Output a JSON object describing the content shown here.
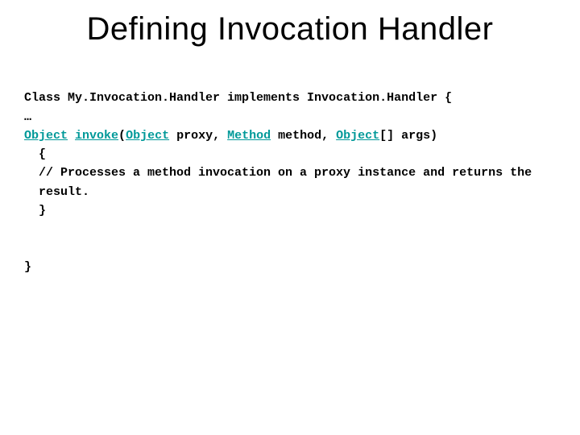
{
  "title": "Defining  Invocation Handler",
  "code": {
    "line1_a": "Class My.Invocation.Handler implements Invocation.Handler {",
    "line2": "…",
    "l3_object": "Object",
    "l3_sp1": " ",
    "l3_invoke": "invoke",
    "l3_paren": "(",
    "l3_object2": "Object",
    "l3_proxy": " proxy, ",
    "l3_method": "Method",
    "l3_methodarg": " method, ",
    "l3_object3": "Object",
    "l3_args": "[] args)",
    "line4": "{",
    "line5": "// Processes a method invocation on a proxy instance and returns the result.",
    "line6": "}",
    "line_blank": "",
    "line_close": "}"
  }
}
